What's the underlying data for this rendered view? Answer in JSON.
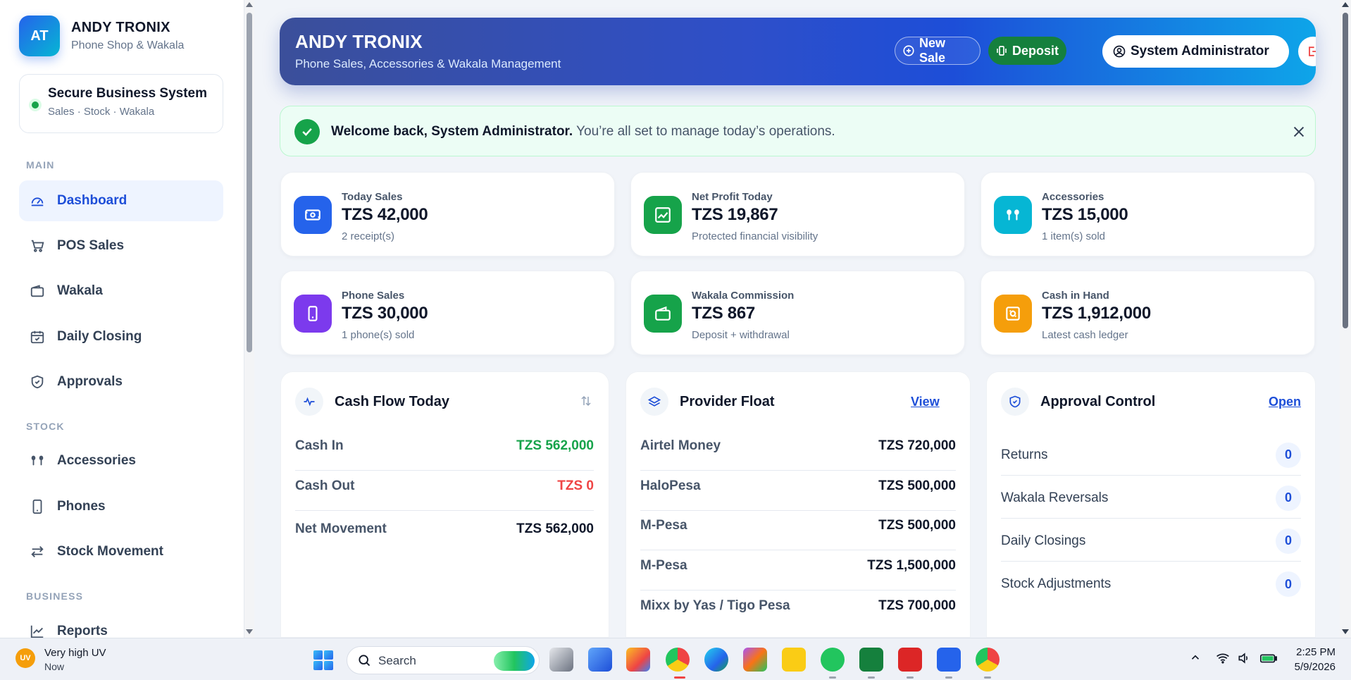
{
  "brand": {
    "initials": "AT",
    "name": "ANDY TRONIX",
    "subtitle": "Phone Shop & Wakala"
  },
  "secure": {
    "title": "Secure Business System",
    "subtitle": "Sales · Stock · Wakala"
  },
  "nav": {
    "sections": {
      "main": "MAIN",
      "stock": "STOCK",
      "business": "BUSINESS"
    },
    "items": {
      "dashboard": "Dashboard",
      "pos_sales": "POS Sales",
      "wakala": "Wakala",
      "daily_closing": "Daily Closing",
      "approvals": "Approvals",
      "accessories": "Accessories",
      "phones": "Phones",
      "stock_movement": "Stock Movement",
      "reports": "Reports"
    }
  },
  "hero": {
    "title": "ANDY TRONIX",
    "subtitle": "Phone Sales, Accessories & Wakala Management",
    "new_sale": "New Sale",
    "deposit": "Deposit",
    "user": "System Administrator"
  },
  "alert": {
    "bold": "Welcome back, System Administrator.",
    "text": " You’re all set to manage today’s operations."
  },
  "stats": [
    {
      "label": "Today Sales",
      "value": "TZS 42,000",
      "note": "2 receipt(s)",
      "color": "#2563eb"
    },
    {
      "label": "Net Profit Today",
      "value": "TZS 19,867",
      "note": "Protected financial visibility",
      "color": "#16a34a"
    },
    {
      "label": "Accessories",
      "value": "TZS 15,000",
      "note": "1 item(s) sold",
      "color": "#06b6d4"
    },
    {
      "label": "Phone Sales",
      "value": "TZS 30,000",
      "note": "1 phone(s) sold",
      "color": "#7c3aed"
    },
    {
      "label": "Wakala Commission",
      "value": "TZS 867",
      "note": "Deposit + withdrawal",
      "color": "#16a34a"
    },
    {
      "label": "Cash in Hand",
      "value": "TZS 1,912,000",
      "note": "Latest cash ledger",
      "color": "#f59e0b"
    }
  ],
  "cashflow": {
    "title": "Cash Flow Today",
    "rows": [
      {
        "label": "Cash In",
        "value": "TZS 562,000"
      },
      {
        "label": "Cash Out",
        "value": "TZS 0"
      },
      {
        "label": "Net Movement",
        "value": "TZS 562,000"
      }
    ],
    "colors": {
      "in": "#16a34a",
      "out": "#ef4444"
    }
  },
  "float": {
    "title": "Provider Float",
    "link": "View",
    "rows": [
      {
        "label": "Airtel Money",
        "value": "TZS 720,000"
      },
      {
        "label": "HaloPesa",
        "value": "TZS 500,000"
      },
      {
        "label": "M-Pesa",
        "value": "TZS 500,000"
      },
      {
        "label": "M-Pesa",
        "value": "TZS 1,500,000"
      },
      {
        "label": "Mixx by Yas / Tigo Pesa",
        "value": "TZS 700,000"
      }
    ]
  },
  "approval": {
    "title": "Approval Control",
    "link": "Open",
    "rows": [
      {
        "label": "Returns",
        "value": "0"
      },
      {
        "label": "Wakala Reversals",
        "value": "0"
      },
      {
        "label": "Daily Closings",
        "value": "0"
      },
      {
        "label": "Stock Adjustments",
        "value": "0"
      }
    ]
  },
  "taskbar": {
    "weather_badge": "UV",
    "weather_title": "Very high UV",
    "weather_sub": "Now",
    "search": "Search",
    "time": "2:25 PM",
    "date": "5/9/2026"
  }
}
